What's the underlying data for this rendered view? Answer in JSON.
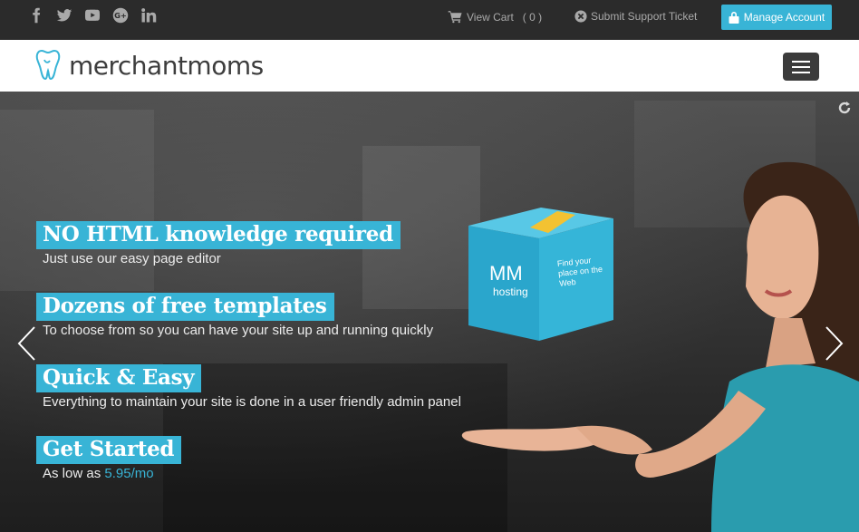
{
  "topbar": {
    "social_icons": [
      "facebook-icon",
      "twitter-icon",
      "youtube-icon",
      "google-plus-icon",
      "linkedin-icon"
    ],
    "cart_label": "View Cart",
    "cart_count": "( 0 )",
    "ticket_label": "Submit Support Ticket",
    "manage_label": "Manage Account"
  },
  "header": {
    "logo_text": "merchantmoms"
  },
  "hero": {
    "slides": [
      {
        "headline": "NO HTML knowledge required",
        "sub": "Just use our easy page editor"
      },
      {
        "headline": "Dozens of free templates",
        "sub": "To choose from so you can have your site up and running quickly"
      },
      {
        "headline": "Quick & Easy",
        "sub": "Everything to maintain your site is done in a user friendly admin panel"
      },
      {
        "headline": "Get Started",
        "sub": "As low as",
        "price": "5.95/mo"
      }
    ],
    "box": {
      "brand": "MM",
      "brand_sub": "hosting",
      "tagline": "Find your place on the Web"
    }
  },
  "colors": {
    "accent": "#38b4d6",
    "topbar": "#2b2b2b",
    "header": "#ffffff"
  }
}
